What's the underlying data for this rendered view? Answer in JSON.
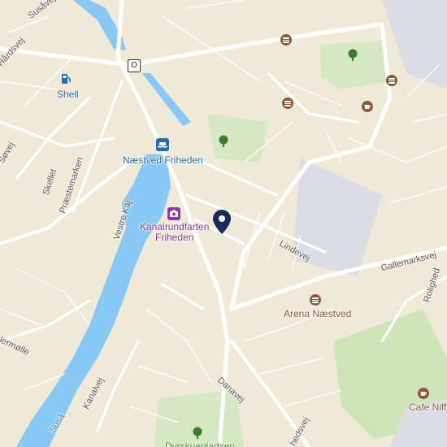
{
  "colors": {
    "land": "#efe9d8",
    "water": "#89c8f5",
    "road": "#ffffff",
    "park": "#d6e8c3",
    "industrial": "#dcdce4",
    "pin": "#1a2a5c",
    "poi_blue": "#2a6bb0",
    "poi_purple": "#8a3aa0",
    "poi_brown": "#8b5a3c"
  },
  "streets": {
    "susaa_top": "Susåvej",
    "hardsvej": "Hårdsvej",
    "sovej": "Søvej",
    "skellet": "Skellet",
    "praestemarken": "Præstemarken",
    "vestre_kaj": "Vestre Kaj",
    "lindevej": "Lindevej",
    "gallemarksvej": "Gallemarksvej",
    "rolighed": "Rolighed",
    "danavej": "Danavej",
    "kanalvej": "Kanalvej",
    "hedsvej": "hedsvej",
    "hermolle": "lermølle",
    "susaa_river": "Suså"
  },
  "route_shield": "O",
  "pois": {
    "shell": {
      "label": "Shell",
      "icon": "fuel-icon"
    },
    "naestved_friheden": {
      "label": "Næstved Friheden",
      "icon": "ferry-icon"
    },
    "kanalrundfarten": {
      "label_line1": "Kanalrundfarten",
      "label_line2": "Friheden",
      "icon": "camera-icon"
    },
    "arena": {
      "label": "Arena Næstved",
      "icon": "burger-icon"
    },
    "cafe": {
      "label": "Cafe Niff",
      "icon": "cup-icon"
    },
    "park_bottom": {
      "label": "Dyrskuepladsen",
      "icon": "tree-icon"
    }
  }
}
